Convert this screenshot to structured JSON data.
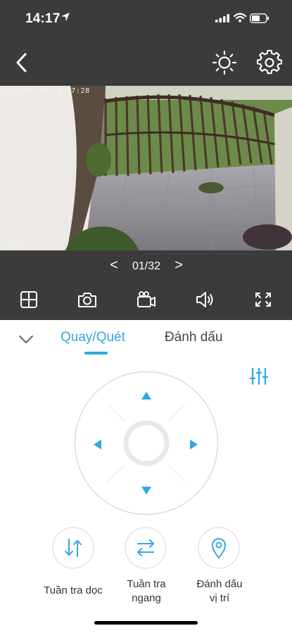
{
  "status_bar": {
    "time": "14:17"
  },
  "camera": {
    "timestamp": "2022-09-10 14:17:28",
    "watermark": "tapo"
  },
  "pager": {
    "prev": "<",
    "page": "01/32",
    "next": ">"
  },
  "tabs": {
    "active": "Quay/Quét",
    "other": "Đánh dấu"
  },
  "actions": {
    "vertical_patrol": "Tuần tra dọc",
    "horizontal_patrol_line1": "Tuần tra",
    "horizontal_patrol_line2": "ngang",
    "mark_position_line1": "Đánh dấu",
    "mark_position_line2": "vị trí"
  },
  "colors": {
    "accent": "#31a8df",
    "dark_bg": "#3b3b3b"
  }
}
